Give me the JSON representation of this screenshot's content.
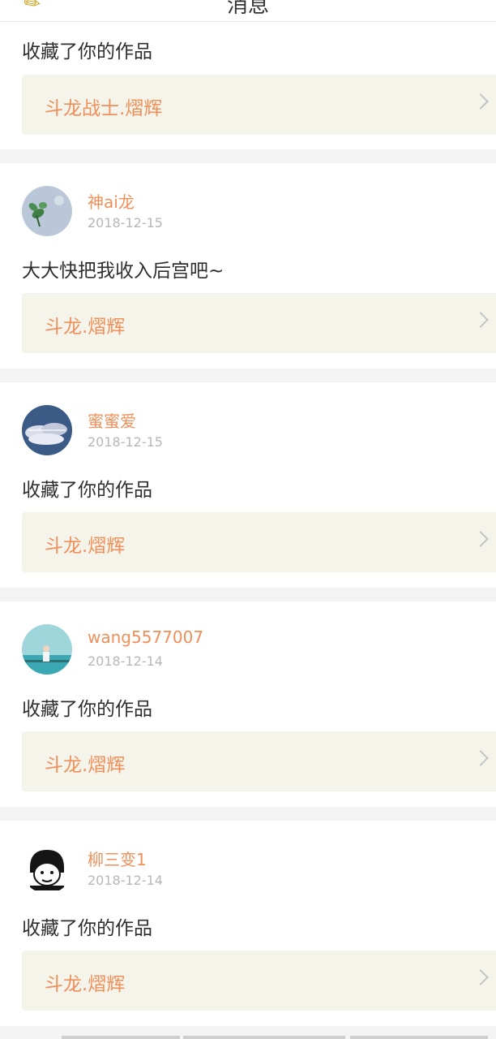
{
  "header": {
    "title": "消息"
  },
  "notifications": [
    {
      "user": "",
      "date": "",
      "message": "收藏了你的作品",
      "work": "斗龙战士.熠辉"
    },
    {
      "user": "神ai龙",
      "date": "2018-12-15",
      "message": "大大快把我收入后宫吧~",
      "work": "斗龙.熠辉"
    },
    {
      "user": "蜜蜜爱",
      "date": "2018-12-15",
      "message": "收藏了你的作品",
      "work": "斗龙.熠辉"
    },
    {
      "user": "wang5577007",
      "date": "2018-12-14",
      "message": "收藏了你的作品",
      "work": "斗龙.熠辉"
    },
    {
      "user": "柳三变1",
      "date": "2018-12-14",
      "message": "收藏了你的作品",
      "work": "斗龙.熠辉"
    }
  ],
  "colors": {
    "accent": "#ef8f5a",
    "work_bg": "#f4f4ea",
    "date": "#b7b7b7"
  }
}
